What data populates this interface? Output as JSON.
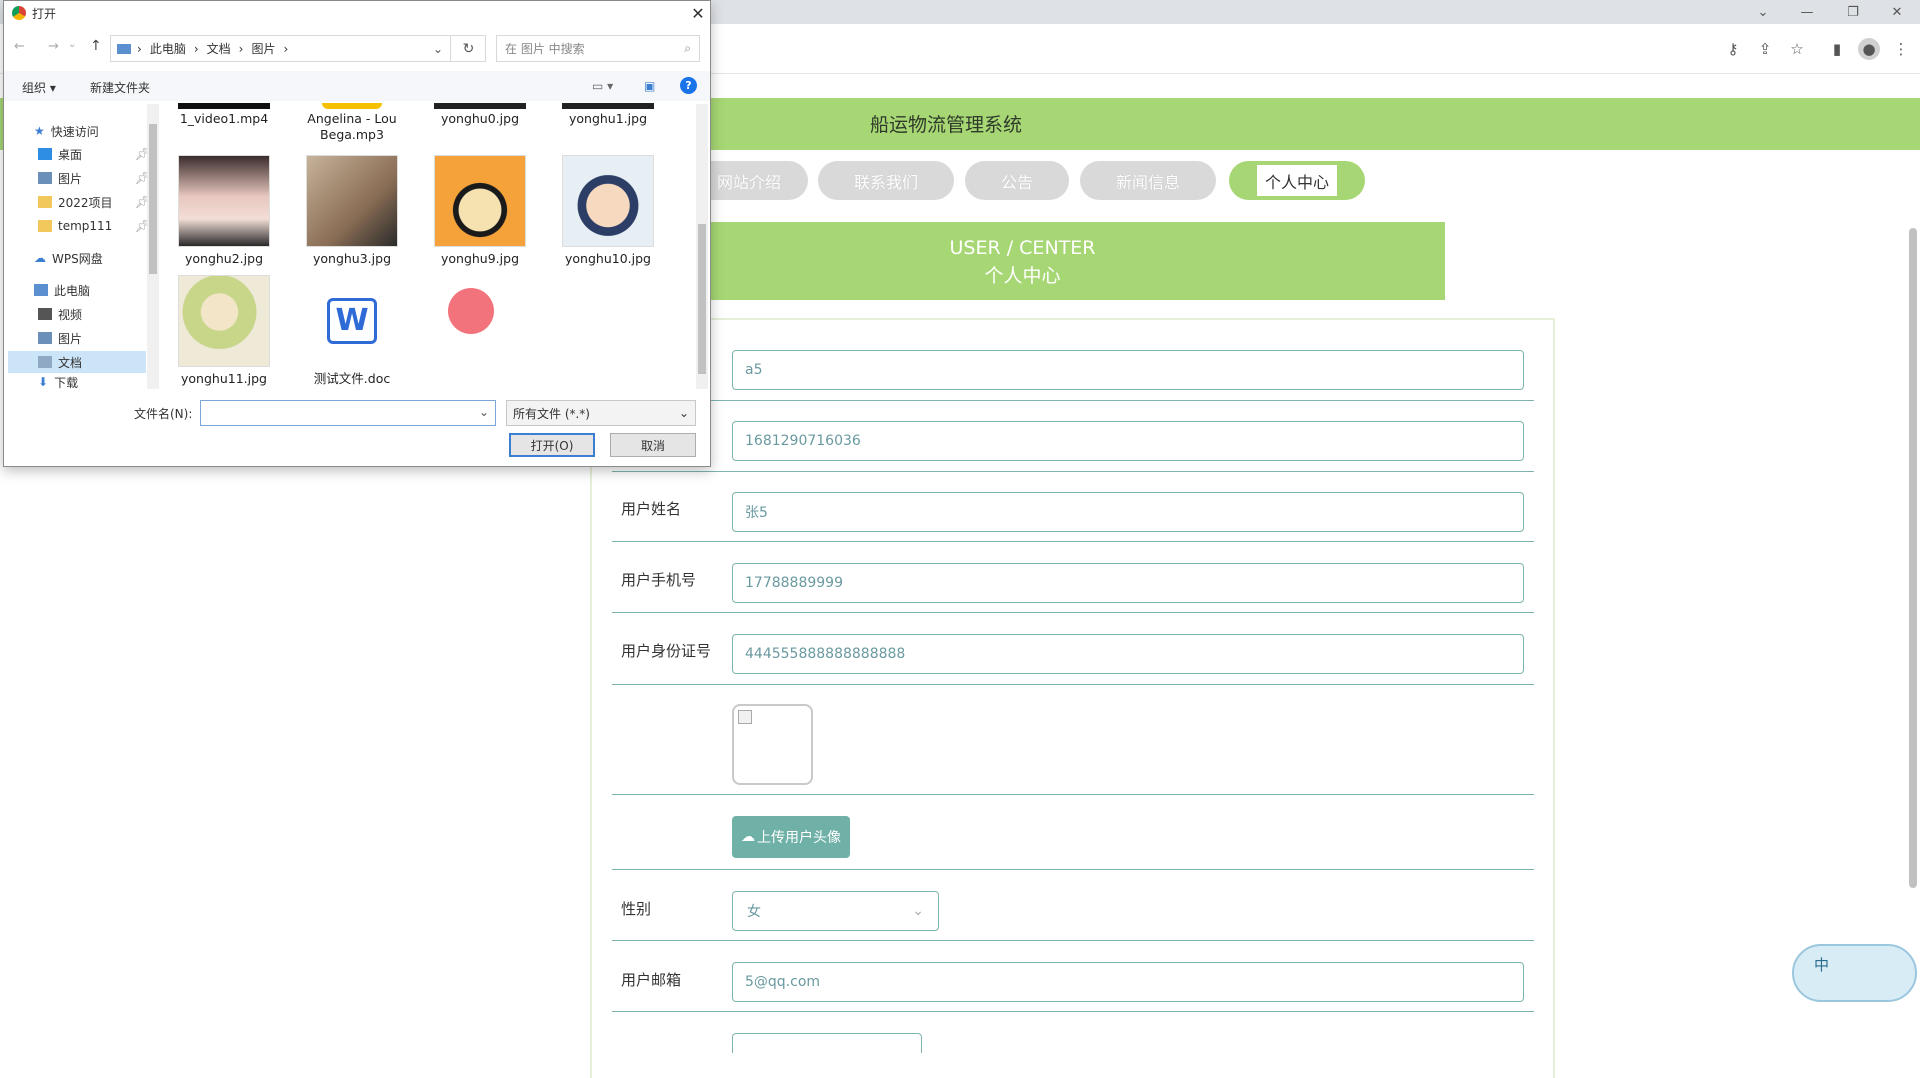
{
  "browser": {
    "window_controls": [
      "⌄",
      "—",
      "❐",
      "✕"
    ],
    "toolbar_icons": [
      "key-icon",
      "share-icon",
      "star-icon",
      "sidepanel-icon",
      "profile-icon",
      "menu-icon"
    ]
  },
  "site": {
    "title": "船运物流管理系统",
    "nav": [
      "网站介绍",
      "联系我们",
      "公告",
      "新闻信息",
      "个人中心"
    ],
    "banner_en": "USER / CENTER",
    "banner_cn": "个人中心"
  },
  "form": {
    "account_value": "a5",
    "number_value": "1681290716036",
    "name_label": "用户姓名",
    "name_value": "张5",
    "phone_label": "用户手机号",
    "phone_value": "17788889999",
    "id_label": "用户身份证号",
    "id_value": "444555888888888888",
    "upload_label": "上传用户头像",
    "sex_label": "性别",
    "sex_value": "女",
    "email_label": "用户邮箱",
    "email_value": "5@qq.com"
  },
  "ime": {
    "label": "中"
  },
  "dialog": {
    "title": "打开",
    "breadcrumb": [
      "此电脑",
      "文档",
      "图片"
    ],
    "search_placeholder": "在 图片 中搜索",
    "organize": "组织 ▾",
    "new_folder": "新建文件夹",
    "nav": {
      "quick_access": "快速访问",
      "desktop": "桌面",
      "pictures": "图片",
      "proj": "2022项目",
      "temp": "temp111",
      "wps": "WPS网盘",
      "this_pc": "此电脑",
      "videos": "视频",
      "pictures2": "图片",
      "documents": "文档",
      "downloads": "下载"
    },
    "top_files": [
      "1_video1.mp4",
      "Angelina - Lou Bega.mp3",
      "yonghu0.jpg",
      "yonghu1.jpg"
    ],
    "files": [
      "yonghu2.jpg",
      "yonghu3.jpg",
      "yonghu9.jpg",
      "yonghu10.jpg",
      "yonghu11.jpg",
      "测试文件.doc"
    ],
    "filename_label": "文件名(N):",
    "filetype": "所有文件 (*.*)",
    "open_button": "打开(O)",
    "cancel_button": "取消"
  }
}
